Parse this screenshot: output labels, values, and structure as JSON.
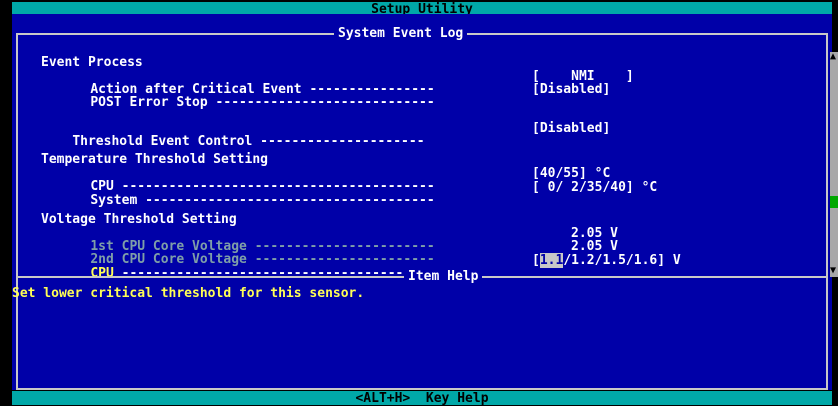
{
  "app": {
    "title": "Setup Utility"
  },
  "main_panel": {
    "title": "System Event Log"
  },
  "sections": {
    "event_process": {
      "heading": "Event Process",
      "rows": [
        {
          "label": "Action after Critical Event",
          "dashes": "----------------",
          "value": "[    NMI    ]"
        },
        {
          "label": "POST Error Stop",
          "dashes": "----------------------------",
          "value": "[Disabled]"
        }
      ]
    },
    "threshold_event_control": {
      "label": "Threshold Event Control",
      "dashes": "---------------------",
      "value": "[Disabled]"
    },
    "temperature": {
      "heading": "Temperature Threshold Setting",
      "rows": [
        {
          "label": "CPU",
          "dashes": "----------------------------------------",
          "value": "[40/55] °C"
        },
        {
          "label": "System",
          "dashes": "-------------------------------------",
          "value": "[ 0/ 2/35/40] °C"
        }
      ]
    },
    "voltage": {
      "heading": "Voltage Threshold Setting",
      "rows": [
        {
          "label": "1st CPU Core Voltage",
          "dashes": "-----------------------",
          "value": "2.05 V"
        },
        {
          "label": "2nd CPU Core Voltage",
          "dashes": "-----------------------",
          "value": "2.05 V"
        }
      ],
      "cpu_row": {
        "label": "CPU",
        "dashes": "----------------------------------------",
        "bracket_open": "[",
        "selected": "1.1",
        "rest": "/1.2/1.5/1.6] V"
      }
    }
  },
  "item_help": {
    "title": "Item Help",
    "text": "Set lower critical threshold for this sensor."
  },
  "footer": {
    "text": "<ALT+H>  Key Help"
  },
  "colors": {
    "panel": "#0000a8",
    "title_bar": "#00a8a8",
    "help_text": "#ffff55",
    "disabled_text": "#7f9fa8",
    "scroll_thumb": "#00a800"
  }
}
